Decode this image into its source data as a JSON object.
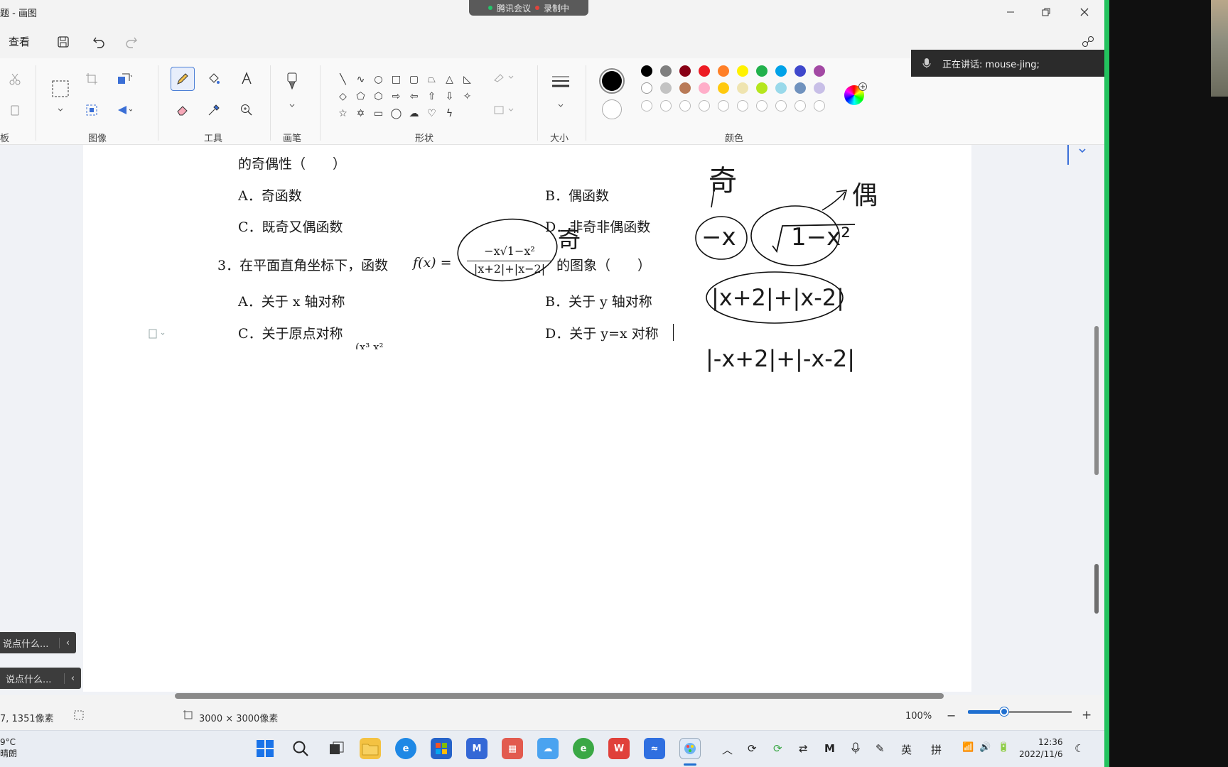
{
  "window": {
    "title": "标题 - 画图",
    "title_visible": "题 - 画图"
  },
  "meeting": {
    "app_label": "腾讯会议",
    "recording_label": "录制中"
  },
  "speaking": {
    "text": "正在讲话: mouse-jing;"
  },
  "menu": {
    "view": "查看"
  },
  "ribbon": {
    "groups": {
      "clipboard": "板",
      "image": "图像",
      "tools": "工具",
      "brushes": "画笔",
      "shapes": "形状",
      "size": "大小",
      "colors": "颜色"
    }
  },
  "colors": {
    "primary": "#000000",
    "secondary": "#ffffff",
    "row1": [
      "#000000",
      "#7f7f7f",
      "#880015",
      "#ed1c24",
      "#ff7f27",
      "#fff200",
      "#22b14c",
      "#00a2e8",
      "#3f48cc",
      "#a349a4"
    ],
    "row2": [
      "#ffffff",
      "#c3c3c3",
      "#b97a57",
      "#ffaec9",
      "#ffc90e",
      "#efe4b0",
      "#b5e61d",
      "#99d9ea",
      "#7092be",
      "#c8bfe7"
    ],
    "row3_count": 10
  },
  "document": {
    "line_parity": "的奇偶性（　　）",
    "q2_options": {
      "a": "A．奇函数",
      "b": "B．偶函数",
      "c": "C．既奇又偶函数",
      "d": "D．非奇非偶函数"
    },
    "q3_prefix": "3．在平面直角坐标下，函数",
    "q3_fx": "f(x) =",
    "q3_numerator": "−x√1−x²",
    "q3_denominator": "|x+2|+|x−2|",
    "q3_suffix": "的图象（　　）",
    "q3_options": {
      "a": "A．关于 x 轴对称",
      "b": "B．关于 y 轴对称",
      "c": "C．关于原点对称",
      "d": "D．关于 y=x 对称"
    },
    "cut_line": "(x³  x²"
  },
  "annotations": {
    "odd": "奇",
    "even": "偶",
    "minus_x": "−x",
    "sqrt_term": "1−x²",
    "abs_sum": "|x+2|+|x-2|",
    "abs_neg": "|-x+2|+|-x-2|",
    "odd_near_formula": "奇"
  },
  "chat": {
    "placeholder1": "说点什么...",
    "placeholder2": "说点什么..."
  },
  "status": {
    "cursor_pos": "7, 1351像素",
    "canvas_size": "3000 × 3000像素",
    "zoom": "100%",
    "zoom_level": 0.35
  },
  "taskbar": {
    "weather_temp": "9°C",
    "weather_text": "晴朗",
    "ime_lang": "英",
    "ime_mode": "拼",
    "time": "12:36",
    "date": "2022/11/6"
  }
}
